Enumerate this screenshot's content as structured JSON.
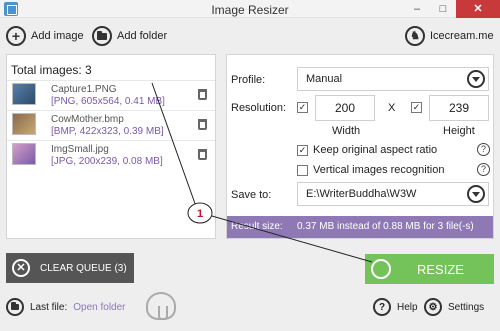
{
  "window": {
    "title": "Image Resizer",
    "minimize_glyph": "–",
    "maximize_glyph": "□",
    "close_glyph": "✕"
  },
  "toolbar": {
    "add_image": "Add image",
    "add_folder": "Add folder",
    "brand": "Icecream.me",
    "add_image_glyph": "+",
    "brand_glyph": "♞"
  },
  "files": {
    "total_label": "Total images: 3",
    "items": [
      {
        "name": "Capture1.PNG",
        "info": "[PNG, 605x564, 0.41 MB]"
      },
      {
        "name": "CowMother.bmp",
        "info": "[BMP, 422x323, 0.39 MB]"
      },
      {
        "name": "ImgSmall.jpg",
        "info": "[JPG, 200x239, 0.08 MB]"
      }
    ]
  },
  "settings": {
    "profile_label": "Profile:",
    "profile_value": "Manual",
    "resolution_label": "Resolution:",
    "width_value": "200",
    "height_value": "239",
    "x_sep": "X",
    "width_label": "Width",
    "height_label": "Height",
    "keep_aspect": "Keep original aspect ratio",
    "vertical_recognition": "Vertical images recognition",
    "save_to_label": "Save to:",
    "save_to_value": "E:\\WriterBuddha\\W3W",
    "result_label": "Result size:",
    "result_value": "0.37 MB instead of 0.88 MB for 3 file(-s)",
    "check_glyph": "✓",
    "help_glyph": "?"
  },
  "actions": {
    "clear_queue": "CLEAR QUEUE (3)",
    "resize": "RESIZE",
    "clear_glyph": "✕"
  },
  "footer": {
    "last_file_label": "Last file:",
    "open_folder": "Open folder",
    "help": "Help",
    "settings": "Settings",
    "help_glyph": "?",
    "settings_glyph": "⚙"
  },
  "annotation": {
    "step_number": "1",
    "accent_color": "#c8102e"
  },
  "colors": {
    "resize_button": "#73c35a",
    "clear_button": "#555555",
    "result_bar": "#8f79b5",
    "file_info_text": "#7a59a8",
    "close_button": "#c7393b"
  }
}
